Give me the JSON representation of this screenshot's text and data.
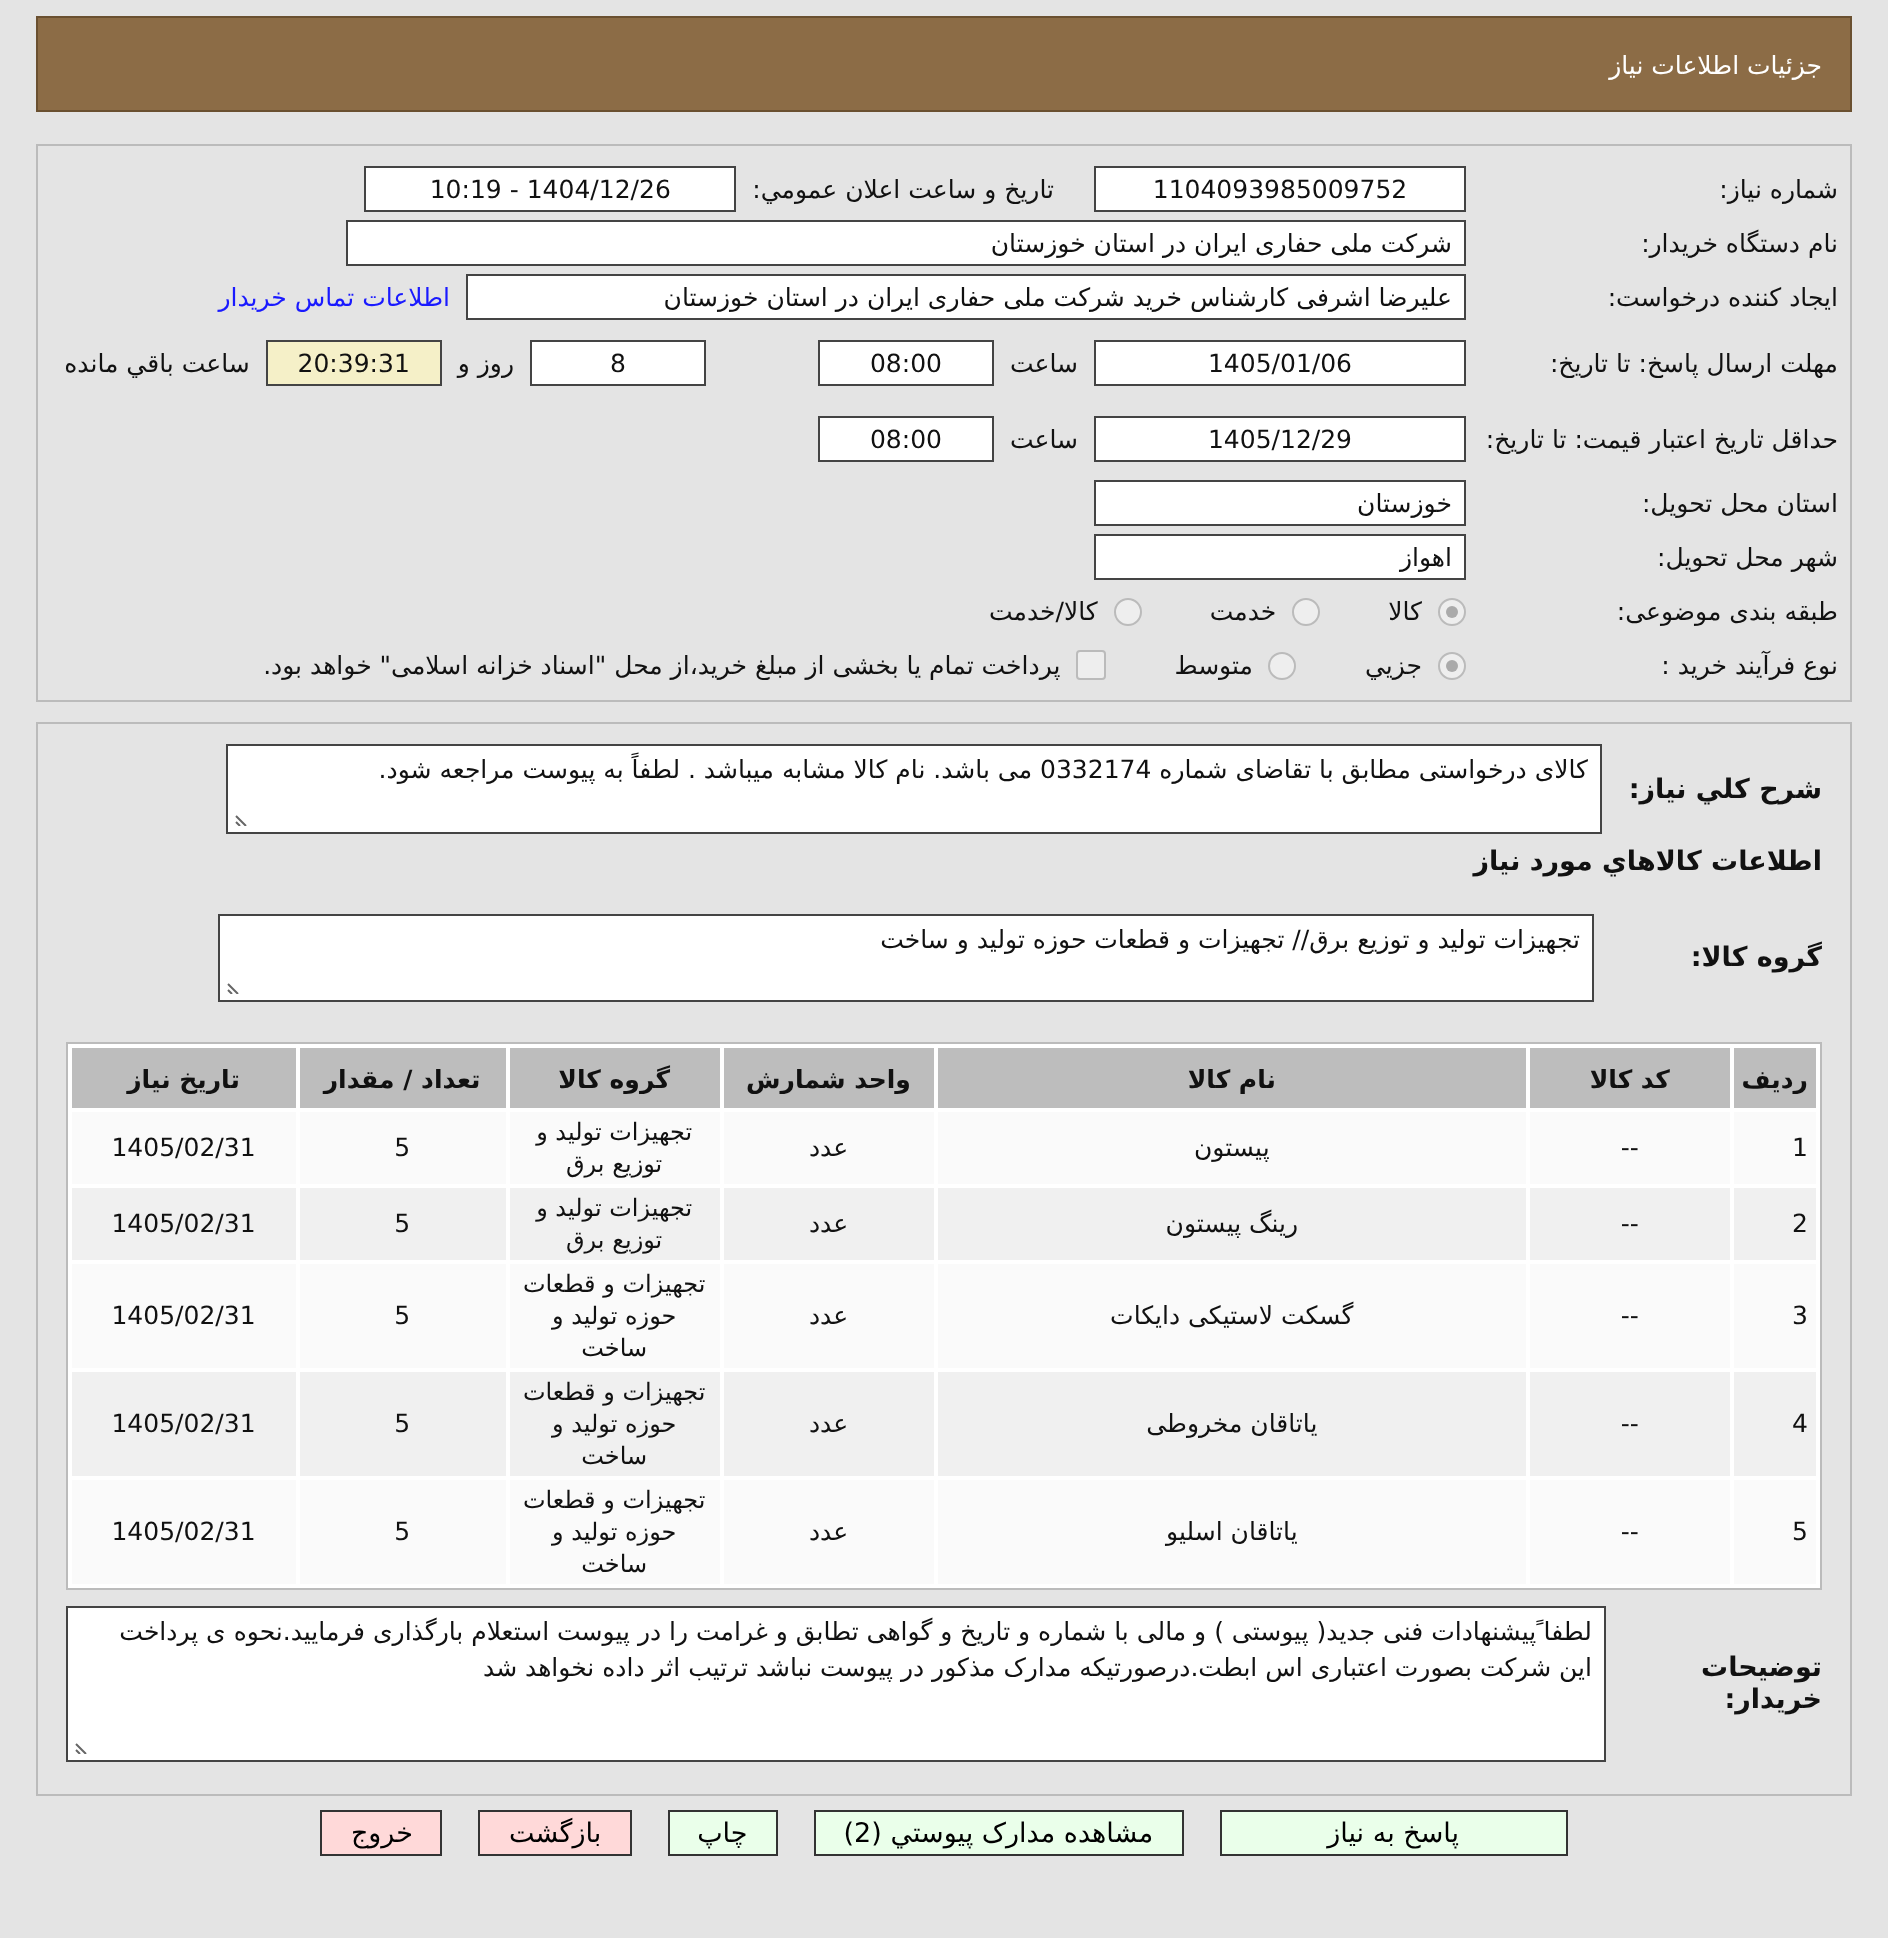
{
  "header": {
    "title": "جزئیات اطلاعات نیاز"
  },
  "need_number": {
    "label": "شماره نیاز:",
    "value": "1104093985009752"
  },
  "announce": {
    "label": "تاریخ و ساعت اعلان عمومي:",
    "value": "1404/12/26 - 10:19"
  },
  "buyer_org": {
    "label": "نام دستگاه خریدار:",
    "value": "شرکت ملی حفاری ایران در استان خوزستان"
  },
  "requester": {
    "label": "ایجاد کننده درخواست:",
    "value": "علیرضا اشرفی کارشناس خرید شرکت ملی حفاری ایران در استان خوزستان",
    "link": "اطلاعات تماس خریدار"
  },
  "deadline": {
    "label": "مهلت ارسال پاسخ: تا تاریخ:",
    "date": "1405/01/06",
    "time_label": "ساعت",
    "time": "08:00",
    "days": "8",
    "days_label": "روز و",
    "remaining": "20:39:31",
    "remaining_label": "ساعت باقي مانده"
  },
  "validity": {
    "label": "حداقل تاریخ اعتبار قیمت: تا تاریخ:",
    "date": "1405/12/29",
    "time_label": "ساعت",
    "time": "08:00"
  },
  "province": {
    "label": "استان محل تحویل:",
    "value": "خوزستان"
  },
  "city": {
    "label": "شهر محل تحویل:",
    "value": "اهواز"
  },
  "category": {
    "label": "طبقه بندی موضوعی:",
    "options": [
      {
        "label": "كالا",
        "selected": true
      },
      {
        "label": "خدمت",
        "selected": false
      },
      {
        "label": "كالا/خدمت",
        "selected": false
      }
    ]
  },
  "process": {
    "label": "نوع فرآیند خرید :",
    "options": [
      {
        "label": "جزيي",
        "selected": true
      },
      {
        "label": "متوسط",
        "selected": false
      }
    ],
    "checkbox": {
      "label": "پرداخت تمام یا بخشی از مبلغ خرید،از محل \"اسناد خزانه اسلامی\" خواهد بود.",
      "checked": false
    }
  },
  "description": {
    "label": "شرح کلي نیاز:",
    "value": "کالای درخواستی مطابق با تقاضای شماره 0332174 می باشد. نام کالا مشابه میباشد . لطفاً به پیوست مراجعه شود."
  },
  "goods_title": "اطلاعات کالاهاي مورد نیاز",
  "goods_group": {
    "label": "گروه کالا:",
    "value": "تجهیزات تولید و توزیع برق// تجهیزات و قطعات حوزه تولید و ساخت"
  },
  "table": {
    "columns": [
      "ردیف",
      "کد کالا",
      "نام کالا",
      "واحد شمارش",
      "گروه کالا",
      "تعداد / مقدار",
      "تاریخ نیاز"
    ],
    "rows": [
      [
        "1",
        "--",
        "پیستون",
        "عدد",
        "تجهیزات تولید و توزیع برق",
        "5",
        "1405/02/31"
      ],
      [
        "2",
        "--",
        "رینگ پیستون",
        "عدد",
        "تجهیزات تولید و توزیع برق",
        "5",
        "1405/02/31"
      ],
      [
        "3",
        "--",
        "گسکت لاستیکی دایکات",
        "عدد",
        "تجهیزات و قطعات حوزه تولید و ساخت",
        "5",
        "1405/02/31"
      ],
      [
        "4",
        "--",
        "یاتاقان مخروطی",
        "عدد",
        "تجهیزات و قطعات حوزه تولید و ساخت",
        "5",
        "1405/02/31"
      ],
      [
        "5",
        "--",
        "یاتاقان اسلیو",
        "عدد",
        "تجهیزات و قطعات حوزه تولید و ساخت",
        "5",
        "1405/02/31"
      ]
    ]
  },
  "buyer_notes": {
    "label": "توضیحات خریدار:",
    "value": "لطفا ًپیشنهادات فنی جدید( پیوستی ) و مالی با شماره و تاریخ و گواهی تطابق و غرامت را در پیوست استعلام بارگذاری فرمایید.نحوه ی پرداخت این شرکت بصورت اعتباری اس ابطت.درصورتیکه مدارک مذکور در پیوست نباشد ترتیب اثر داده نخواهد شد"
  },
  "buttons": [
    {
      "label": "پاسخ به نیاز",
      "kind": "action"
    },
    {
      "label": "مشاهده مدارک پیوستي (2)",
      "kind": "action"
    },
    {
      "label": "چاپ",
      "kind": "action"
    },
    {
      "label": "بازگشت",
      "kind": "exit"
    },
    {
      "label": "خروج",
      "kind": "exit"
    }
  ]
}
